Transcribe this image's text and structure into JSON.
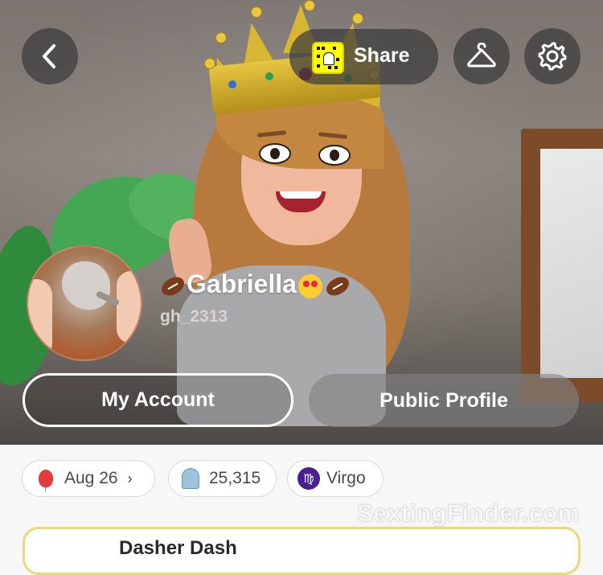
{
  "header": {
    "back_icon": "chevron-left-icon",
    "share_label": "Share",
    "closet_icon": "hanger-icon",
    "settings_icon": "gear-icon"
  },
  "profile": {
    "display_name": "Gabriella",
    "username": "gh_2313"
  },
  "actions": {
    "my_account_label": "My Account",
    "public_profile_label": "Public Profile"
  },
  "chips": {
    "birthday": "Aug 26",
    "snap_score": "25,315",
    "zodiac": "Virgo"
  },
  "card": {
    "title": "Dasher Dash"
  },
  "watermark": "SextingFinder.com",
  "colors": {
    "snapchat_yellow": "#fffc00",
    "zodiac_purple": "#4b1f8f",
    "card_border": "#f0d67a"
  }
}
